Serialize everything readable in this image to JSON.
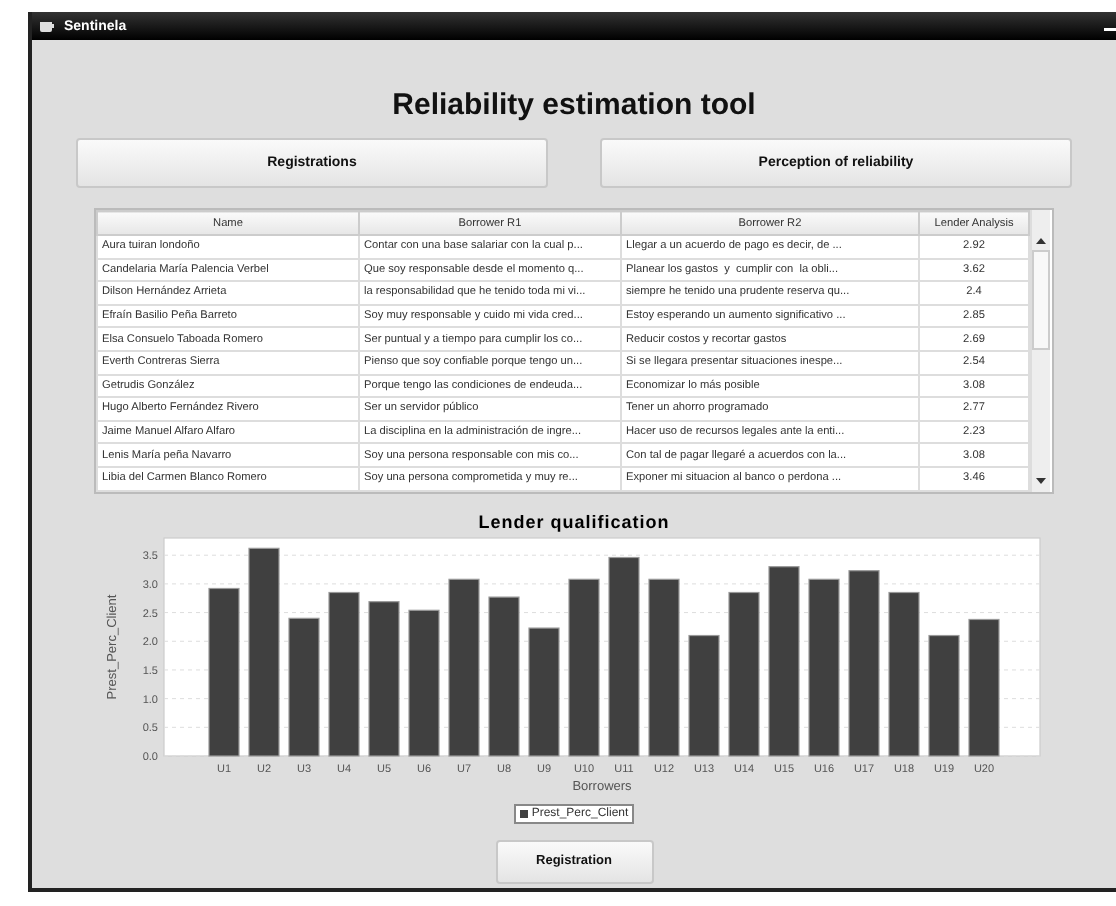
{
  "window": {
    "title": "Sentinela"
  },
  "heading": "Reliability estimation tool",
  "top_buttons": [
    "Registrations",
    "Perception of reliability"
  ],
  "table": {
    "columns": [
      "Name",
      "Borrower R1",
      "Borrower R2",
      "Lender Analysis"
    ],
    "rows": [
      [
        "Aura tuiran londoño",
        "Contar con una base salariar con la cual p...",
        "Llegar a un acuerdo de pago es decir, de ...",
        "2.92"
      ],
      [
        "Candelaria María Palencia Verbel",
        "Que soy responsable desde el momento q...",
        "Planear los gastos  y  cumplir con  la obli...",
        "3.62"
      ],
      [
        "Dilson Hernández Arrieta",
        "la responsabilidad que he tenido toda mi vi...",
        "siempre he tenido una prudente reserva qu...",
        "2.4"
      ],
      [
        "Efraín Basilio Peña Barreto",
        "Soy muy responsable y cuido mi vida cred...",
        "Estoy esperando un aumento significativo ...",
        "2.85"
      ],
      [
        "Elsa Consuelo Taboada Romero",
        "Ser puntual y a tiempo para cumplir los co...",
        "Reducir costos y recortar gastos",
        "2.69"
      ],
      [
        "Everth Contreras Sierra",
        "Pienso que soy confiable porque tengo un...",
        "Si se llegara presentar situaciones inespe...",
        "2.54"
      ],
      [
        "Getrudis González",
        "Porque tengo las condiciones de endeuda...",
        "Economizar lo más posible",
        "3.08"
      ],
      [
        "Hugo Alberto Fernández Rivero",
        "Ser un servidor público",
        "Tener un ahorro programado",
        "2.77"
      ],
      [
        "Jaime Manuel Alfaro Alfaro",
        "La disciplina en la administración de ingre...",
        "Hacer uso de recursos legales ante la enti...",
        "2.23"
      ],
      [
        "Lenis María peña Navarro",
        "Soy una persona responsable con mis co...",
        "Con tal de pagar llegaré a acuerdos con la...",
        "3.08"
      ],
      [
        "Libia del Carmen Blanco Romero",
        "Soy una persona comprometida y muy re...",
        "Exponer mi situacion al banco o perdona ...",
        "3.46"
      ]
    ]
  },
  "chart": {
    "chart_data": {
      "type": "bar",
      "title": "Lender qualification",
      "xlabel": "Borrowers",
      "ylabel": "Prest_Perc_Client",
      "categories": [
        "U1",
        "U2",
        "U3",
        "U4",
        "U5",
        "U6",
        "U7",
        "U8",
        "U9",
        "U10",
        "U11",
        "U12",
        "U13",
        "U14",
        "U15",
        "U16",
        "U17",
        "U18",
        "U19",
        "U20"
      ],
      "series": [
        {
          "name": "Prest_Perc_Client",
          "color": "#404040",
          "values": [
            2.92,
            3.62,
            2.4,
            2.85,
            2.69,
            2.54,
            3.08,
            2.77,
            2.23,
            3.08,
            3.46,
            3.08,
            2.1,
            2.85,
            3.3,
            3.08,
            3.23,
            2.85,
            2.1,
            2.38
          ]
        }
      ],
      "ylim": [
        0,
        3.8
      ],
      "grid": true,
      "yticks": [
        {
          "value": 0,
          "label": "0.0"
        },
        {
          "value": 0.5,
          "label": "0.5"
        },
        {
          "value": 1,
          "label": "1.0"
        },
        {
          "value": 1.5,
          "label": "1.5"
        },
        {
          "value": 2,
          "label": "2.0"
        },
        {
          "value": 2.5,
          "label": "2.5"
        },
        {
          "value": 3,
          "label": "3.0"
        },
        {
          "value": 3.5,
          "label": "3.5"
        }
      ]
    }
  },
  "bottom_button": "Registration"
}
